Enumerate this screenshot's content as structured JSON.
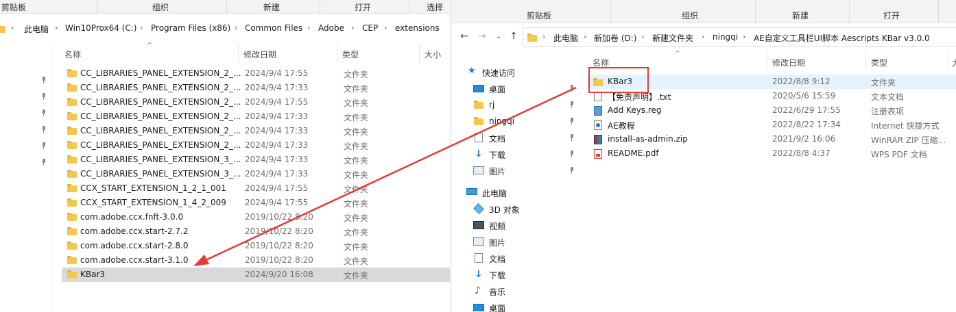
{
  "left": {
    "ribbon": {
      "clipboard": "剪贴板",
      "organize": "组织",
      "new": "新建",
      "open": "打开",
      "select": "选择"
    },
    "breadcrumb": [
      "此电脑",
      "Win10Prox64 (C:)",
      "Program Files (x86)",
      "Common Files",
      "Adobe",
      "CEP",
      "extensions"
    ],
    "columns": {
      "name": "名称",
      "date": "修改日期",
      "type": "类型",
      "size": "大小"
    },
    "rows": [
      {
        "name": "CC_LIBRARIES_PANEL_EXTENSION_2_...",
        "date": "2024/9/4 17:55",
        "type": "文件夹"
      },
      {
        "name": "CC_LIBRARIES_PANEL_EXTENSION_2_...",
        "date": "2024/9/4 17:33",
        "type": "文件夹"
      },
      {
        "name": "CC_LIBRARIES_PANEL_EXTENSION_2_...",
        "date": "2024/9/4 17:55",
        "type": "文件夹"
      },
      {
        "name": "CC_LIBRARIES_PANEL_EXTENSION_2_...",
        "date": "2024/9/4 17:33",
        "type": "文件夹"
      },
      {
        "name": "CC_LIBRARIES_PANEL_EXTENSION_2_...",
        "date": "2024/9/4 17:33",
        "type": "文件夹"
      },
      {
        "name": "CC_LIBRARIES_PANEL_EXTENSION_2_...",
        "date": "2024/9/4 17:33",
        "type": "文件夹"
      },
      {
        "name": "CC_LIBRARIES_PANEL_EXTENSION_3_...",
        "date": "2024/9/4 17:33",
        "type": "文件夹"
      },
      {
        "name": "CC_LIBRARIES_PANEL_EXTENSION_3_...",
        "date": "2024/9/4 17:33",
        "type": "文件夹"
      },
      {
        "name": "CCX_START_EXTENSION_1_2_1_001",
        "date": "2024/9/4 17:55",
        "type": "文件夹"
      },
      {
        "name": "CCX_START_EXTENSION_1_4_2_009",
        "date": "2024/9/4 17:55",
        "type": "文件夹"
      },
      {
        "name": "com.adobe.ccx.fnft-3.0.0",
        "date": "2019/10/22 8:20",
        "type": "文件夹"
      },
      {
        "name": "com.adobe.ccx.start-2.7.2",
        "date": "2019/10/22 8:20",
        "type": "文件夹"
      },
      {
        "name": "com.adobe.ccx.start-2.8.0",
        "date": "2019/10/22 8:20",
        "type": "文件夹"
      },
      {
        "name": "com.adobe.ccx.start-3.1.0",
        "date": "2019/10/22 8:20",
        "type": "文件夹"
      },
      {
        "name": "KBar3",
        "date": "2024/9/20 16:08",
        "type": "文件夹"
      }
    ]
  },
  "right": {
    "ribbon": {
      "clipboard": "剪贴板",
      "organize": "组织",
      "new": "新建",
      "open": "打开"
    },
    "breadcrumb": [
      "此电脑",
      "新加卷 (D:)",
      "新建文件夹",
      "ningqi",
      "AE自定义工具栏UI脚本 Aescripts KBar v3.0.0"
    ],
    "nav": {
      "quick_access": "快速访问",
      "pinned": [
        "桌面",
        "rj",
        "ningqi",
        "文档",
        "下载",
        "图片"
      ],
      "this_pc": "此电脑",
      "pc_items": [
        "3D 对象",
        "视频",
        "图片",
        "文档",
        "下载",
        "音乐",
        "桌面"
      ]
    },
    "columns": {
      "name": "名称",
      "date": "修改日期",
      "type": "类型",
      "size": "大"
    },
    "rows": [
      {
        "name": "KBar3",
        "date": "2022/8/8 9:12",
        "type": "文件夹",
        "icon": "folder-icon"
      },
      {
        "name": "【免责声明】.txt",
        "date": "2020/5/6 15:59",
        "type": "文本文档",
        "icon": "text-file-icon"
      },
      {
        "name": "Add Keys.reg",
        "date": "2022/6/29 17:55",
        "type": "注册表项",
        "icon": "registry-file-icon"
      },
      {
        "name": "AE教程",
        "date": "2022/8/22 17:34",
        "type": "Internet 快捷方式",
        "icon": "internet-shortcut-icon"
      },
      {
        "name": "install-as-admin.zip",
        "date": "2021/9/2 16:06",
        "type": "WinRAR ZIP 压缩...",
        "icon": "zip-file-icon"
      },
      {
        "name": "README.pdf",
        "date": "2022/8/8 4:37",
        "type": "WPS PDF 文档",
        "icon": "pdf-file-icon"
      }
    ]
  },
  "colors": {
    "highlight_box": "#e53935",
    "arrow": "#e53935",
    "folder": "#f4c84e",
    "selected_row": "#d9d9d9",
    "hover_row": "#e5f3ff"
  }
}
